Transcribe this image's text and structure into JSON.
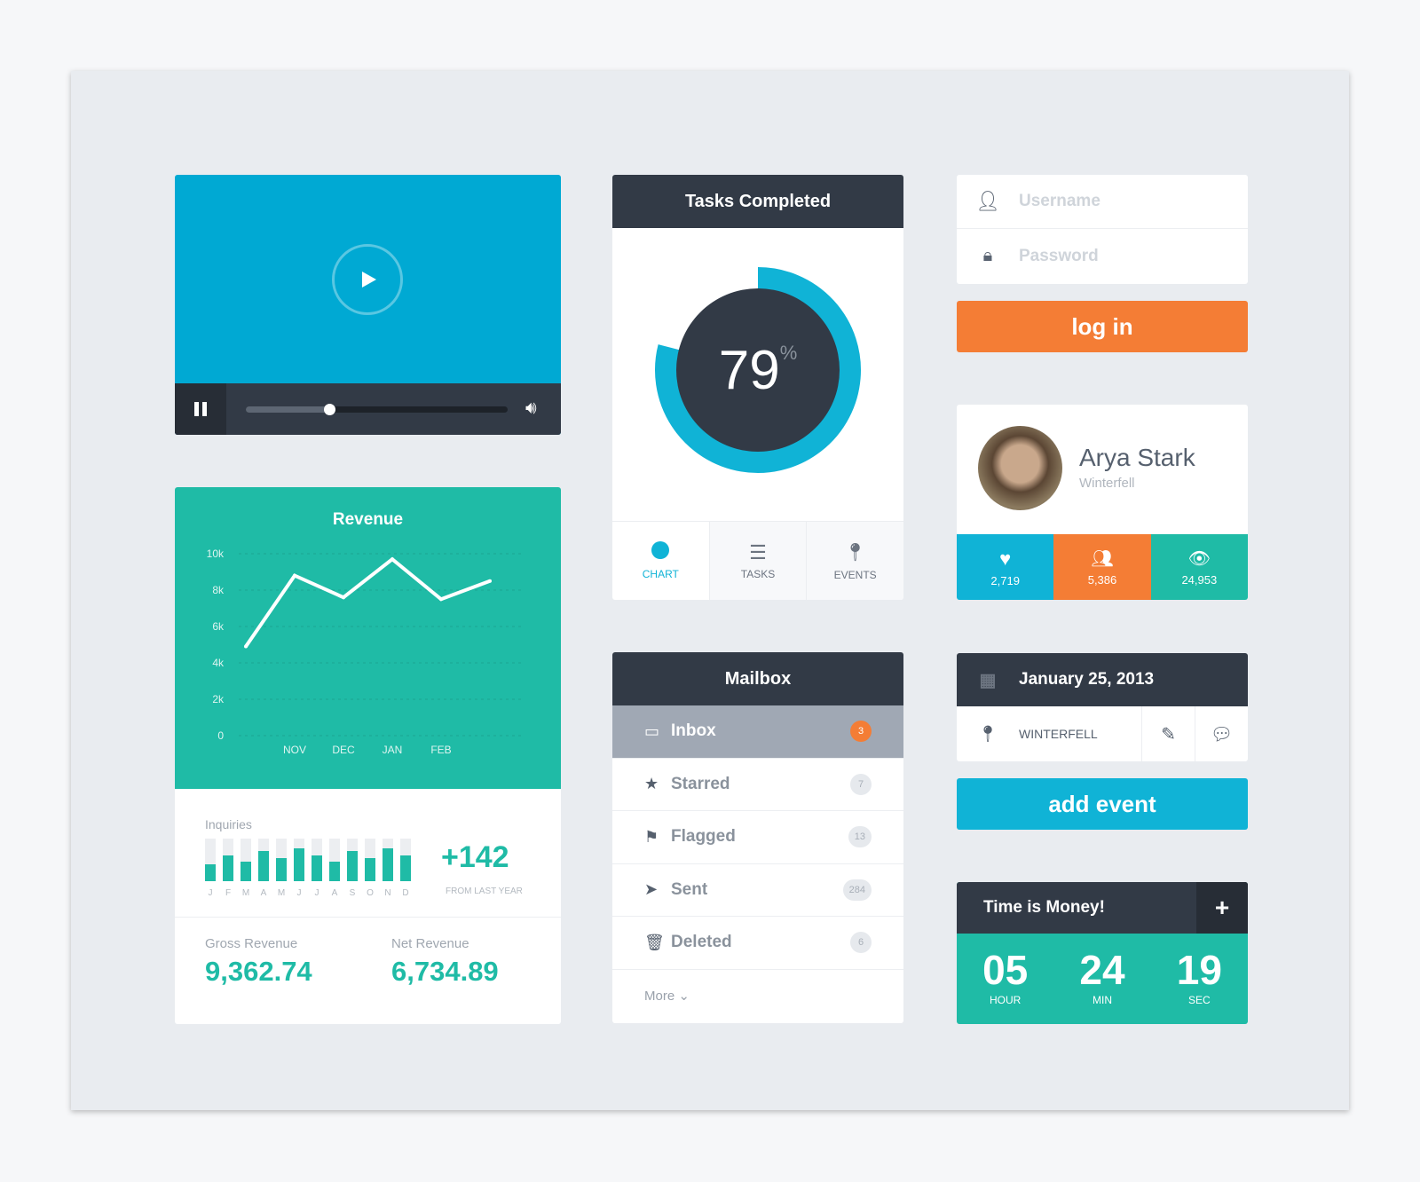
{
  "colors": {
    "teal": "#1fbba6",
    "blue": "#10b3d6",
    "orange": "#f47d35",
    "dark": "#323a46",
    "video": "#00a9d3"
  },
  "video": {
    "progress": 0.32,
    "buffered": 0.32,
    "icons": [
      "play-icon",
      "pause-icon",
      "volume-icon"
    ]
  },
  "revenue": {
    "title": "Revenue",
    "inquiries_label": "Inquiries",
    "delta": "+142",
    "delta_label": "FROM LAST YEAR",
    "months": [
      "J",
      "F",
      "M",
      "A",
      "M",
      "J",
      "J",
      "A",
      "S",
      "O",
      "N",
      "D"
    ],
    "gross_label": "Gross Revenue",
    "gross": "9,362.74",
    "net_label": "Net Revenue",
    "net": "6,734.89"
  },
  "chart_data": [
    {
      "type": "line",
      "title": "Revenue",
      "yticks": [
        "0",
        "2k",
        "4k",
        "6k",
        "8k",
        "10k"
      ],
      "ylim": [
        0,
        10000
      ],
      "categories": [
        "",
        "NOV",
        "DEC",
        "JAN",
        "FEB",
        ""
      ],
      "values": [
        4900,
        8800,
        7600,
        9700,
        7500,
        8500
      ],
      "grid": true
    },
    {
      "type": "bar",
      "title": "Inquiries",
      "categories": [
        "J",
        "F",
        "M",
        "A",
        "M",
        "J",
        "J",
        "A",
        "S",
        "O",
        "N",
        "D"
      ],
      "values": [
        0.4,
        0.6,
        0.45,
        0.7,
        0.55,
        0.78,
        0.6,
        0.45,
        0.7,
        0.55,
        0.78,
        0.6
      ],
      "ylim": [
        0,
        1
      ]
    }
  ],
  "tasks": {
    "title": "Tasks Completed",
    "percent": 79,
    "value": "79",
    "unit": "%",
    "tabs": [
      {
        "label": "CHART",
        "icon": "pie-chart-icon",
        "active": true
      },
      {
        "label": "TASKS",
        "icon": "list-icon"
      },
      {
        "label": "EVENTS",
        "icon": "map-pin-icon"
      }
    ]
  },
  "mailbox": {
    "title": "Mailbox",
    "more": "More ⌄",
    "items": [
      {
        "label": "Inbox",
        "count": "3",
        "icon": "inbox-icon",
        "active": true
      },
      {
        "label": "Starred",
        "count": "7",
        "icon": "star-icon"
      },
      {
        "label": "Flagged",
        "count": "13",
        "icon": "flag-icon"
      },
      {
        "label": "Sent",
        "count": "284",
        "icon": "send-icon"
      },
      {
        "label": "Deleted",
        "count": "6",
        "icon": "trash-icon"
      }
    ]
  },
  "login": {
    "username_placeholder": "Username",
    "password_placeholder": "Password",
    "button": "log in"
  },
  "profile": {
    "name": "Arya Stark",
    "location": "Winterfell",
    "stats": [
      {
        "icon": "heart-icon",
        "value": "2,719"
      },
      {
        "icon": "users-icon",
        "value": "5,386"
      },
      {
        "icon": "eye-icon",
        "value": "24,953"
      }
    ]
  },
  "event": {
    "date": "January 25, 2013",
    "location": "WINTERFELL",
    "button": "add event"
  },
  "timer": {
    "title": "Time is Money!",
    "hour": "05",
    "min": "24",
    "sec": "19",
    "hour_label": "HOUR",
    "min_label": "MIN",
    "sec_label": "SEC"
  }
}
